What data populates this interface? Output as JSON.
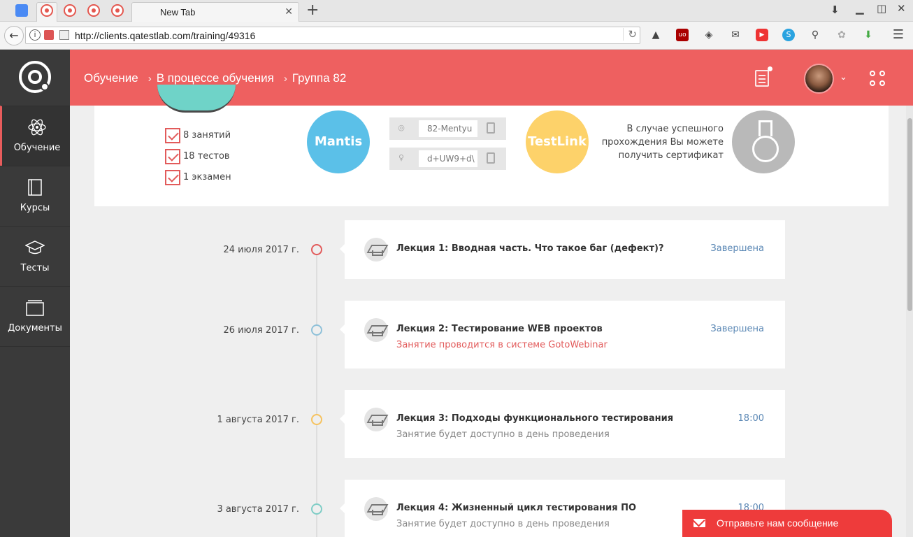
{
  "browser": {
    "tab_title": "New Tab",
    "url": "http://clients.qatestlab.com/training/49316"
  },
  "sidebar": {
    "items": [
      {
        "label": "Обучение",
        "icon": "atom-icon"
      },
      {
        "label": "Курсы",
        "icon": "book-icon"
      },
      {
        "label": "Тесты",
        "icon": "graduation-cap-icon"
      },
      {
        "label": "Документы",
        "icon": "folder-icon"
      }
    ]
  },
  "header": {
    "breadcrumb": [
      "Обучение",
      "В процессе обучения",
      "Группа 82"
    ],
    "separator": "›"
  },
  "info": {
    "stats": [
      "8 занятий",
      "18 тестов",
      "1 экзамен"
    ],
    "mantis_label": "Mantis",
    "testlink_label": "TestLink",
    "login_value": "82-Mentyu",
    "password_value": "d+UW9+d\\",
    "certificate_text": [
      "В случае успешного",
      "прохождения Вы можете",
      "получить сертификат"
    ]
  },
  "timeline": [
    {
      "date": "24 июля 2017 г.",
      "title": "Лекция 1: Вводная часть. Что такое баг (дефект)?",
      "subtitle": "",
      "status": "Завершена",
      "dot_color": "#e25b5b"
    },
    {
      "date": "26 июля 2017 г.",
      "title": "Лекция 2: Тестирование WEB проектов",
      "subtitle": "Занятие проводится в системе GotoWebinar",
      "status": "Завершена",
      "dot_color": "#8fc1d9"
    },
    {
      "date": "1 августа 2017 г.",
      "title": "Лекция 3: Подходы функционального тестирования",
      "subtitle": "Занятие будет доступно в день проведения",
      "status": "18:00",
      "dot_color": "#f6c25e"
    },
    {
      "date": "3 августа 2017 г.",
      "title": "Лекция 4: Жизненный цикл тестирования ПО",
      "subtitle": "Занятие будет доступно в день проведения",
      "status": "18:00",
      "dot_color": "#7fcdc6"
    }
  ],
  "chat": {
    "label": "Отправьте нам сообщение"
  },
  "colors": {
    "brand": "#ee6060",
    "sidebar": "#3a3a3a",
    "status_link": "#5b88b5",
    "subtitle_red": "#e25b5b"
  }
}
